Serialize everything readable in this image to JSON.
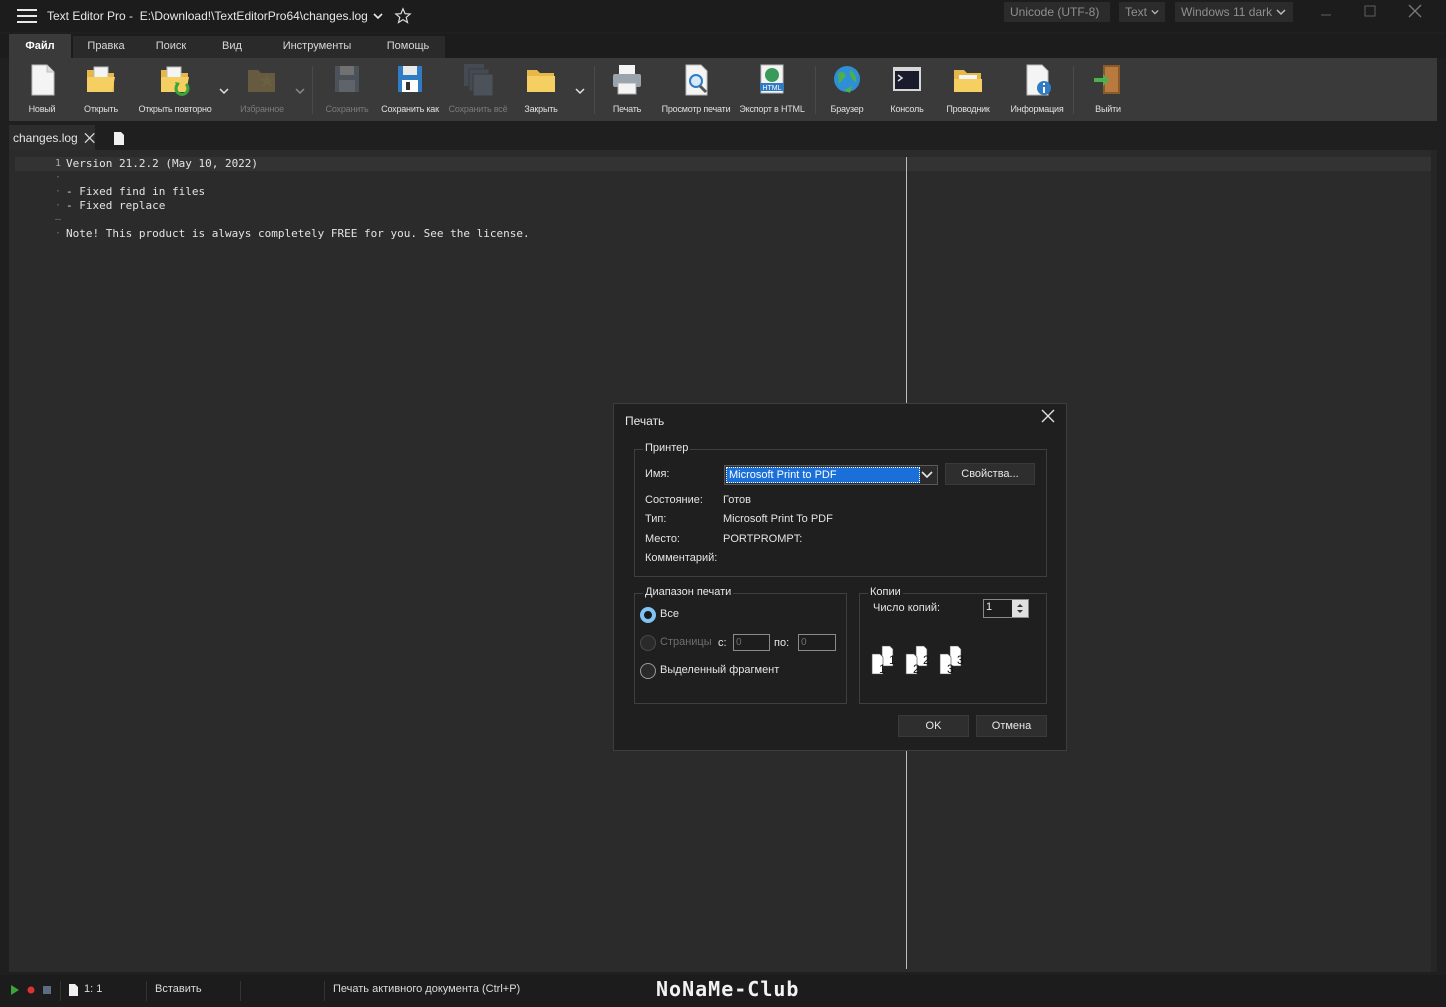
{
  "window": {
    "app_title": "Text Editor Pro",
    "separator": "-",
    "file_path": "E:\\Download!\\TextEditorPro64\\changes.log",
    "encoding": "Unicode (UTF-8)",
    "syntax": "Text",
    "theme": "Windows 11 dark"
  },
  "menu": {
    "tabs": [
      "Файл",
      "Правка",
      "Поиск",
      "Вид",
      "Инструменты",
      "Помощь"
    ],
    "active": "Файл"
  },
  "ribbon": {
    "new": "Новый",
    "open": "Открыть",
    "reopen": "Открыть повторно",
    "favorites": "Избранное",
    "save": "Сохранить",
    "save_as": "Сохранить как",
    "save_all": "Сохранить всё",
    "close": "Закрыть",
    "print": "Печать",
    "print_preview": "Просмотр печати",
    "export_html": "Экспорт в HTML",
    "browser": "Браузер",
    "console": "Консоль",
    "explorer": "Проводник",
    "info": "Информация",
    "exit": "Выйти"
  },
  "doc_tabs": [
    {
      "name": "changes.log"
    }
  ],
  "editor": {
    "lines": [
      {
        "gutter": "1",
        "text": "Version 21.2.2 (May 10, 2022)"
      },
      {
        "gutter": "·",
        "text": ""
      },
      {
        "gutter": "·",
        "text": "- Fixed find in files"
      },
      {
        "gutter": "·",
        "text": "- Fixed replace"
      },
      {
        "gutter": "–",
        "text": ""
      },
      {
        "gutter": "·",
        "text": "Note! This product is always completely FREE for you. See the license."
      }
    ]
  },
  "status": {
    "position": "1: 1",
    "mode": "Вставить",
    "hint": "Печать активного документа (Ctrl+P)",
    "watermark": "NoNaMe-Club"
  },
  "print_dialog": {
    "title": "Печать",
    "printer_group": "Принтер",
    "name_label": "Имя:",
    "printer_name": "Microsoft Print to PDF",
    "properties_button": "Свойства...",
    "state_label": "Состояние:",
    "state_value": "Готов",
    "type_label": "Тип:",
    "type_value": "Microsoft Print To PDF",
    "where_label": "Место:",
    "where_value": "PORTPROMPT:",
    "comment_label": "Комментарий:",
    "range_group": "Диапазон печати",
    "range_all": "Все",
    "range_pages": "Страницы",
    "from_label": "с:",
    "from_value": "0",
    "to_label": "по:",
    "to_value": "0",
    "range_selection": "Выделенный фрагмент",
    "copies_group": "Копии",
    "copies_label": "Число копий:",
    "copies_value": "1",
    "collate_pages": [
      "1",
      "1",
      "2",
      "2",
      "3",
      "3"
    ],
    "ok": "OK",
    "cancel": "Отмена"
  }
}
